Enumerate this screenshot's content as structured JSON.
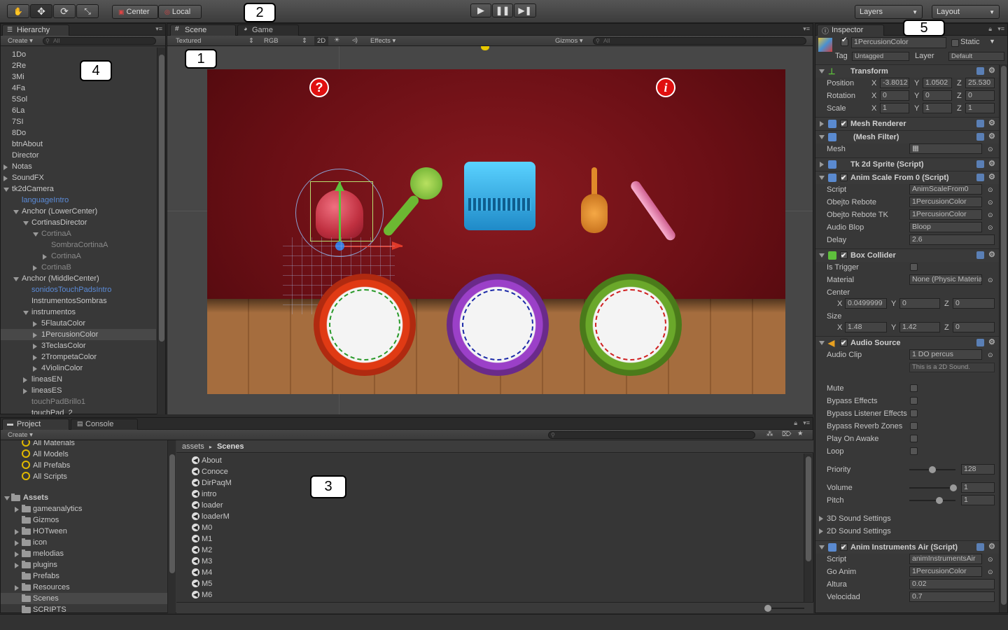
{
  "toolbar": {
    "pivot_center": "Center",
    "pivot_local": "Local",
    "layers": "Layers",
    "layout": "Layout"
  },
  "markers": [
    "1",
    "2",
    "3",
    "4",
    "5"
  ],
  "hierarchy": {
    "tab": "Hierarchy",
    "create": "Create",
    "search_placeholder": "All",
    "items": [
      {
        "label": "1Do"
      },
      {
        "label": "2Re"
      },
      {
        "label": "3Mi"
      },
      {
        "label": "4Fa"
      },
      {
        "label": "5Sol"
      },
      {
        "label": "6La"
      },
      {
        "label": "7SI"
      },
      {
        "label": "8Do"
      },
      {
        "label": "btnAbout"
      },
      {
        "label": "Director"
      },
      {
        "label": "Notas"
      },
      {
        "label": "SoundFX"
      },
      {
        "label": "tk2dCamera"
      },
      {
        "label": "languageIntro"
      },
      {
        "label": "Anchor (LowerCenter)"
      },
      {
        "label": "CortinasDirector"
      },
      {
        "label": "CortinaA"
      },
      {
        "label": "SombraCortinaA"
      },
      {
        "label": "CortinaA"
      },
      {
        "label": "CortinaB"
      },
      {
        "label": "Anchor (MiddleCenter)"
      },
      {
        "label": "sonidosTouchPadsIntro"
      },
      {
        "label": "InstrumentosSombras"
      },
      {
        "label": "instrumentos"
      },
      {
        "label": "5FlautaColor"
      },
      {
        "label": "1PercusionColor"
      },
      {
        "label": "3TeclasColor"
      },
      {
        "label": "2TrompetaColor"
      },
      {
        "label": "4ViolinColor"
      },
      {
        "label": "lineasEN"
      },
      {
        "label": "lineasES"
      },
      {
        "label": "touchPadBrillo1"
      },
      {
        "label": "touchPad_2"
      }
    ]
  },
  "scene": {
    "tab_scene": "Scene",
    "tab_game": "Game",
    "render_mode": "Textured",
    "color_mode": "RGB",
    "mode_2d": "2D",
    "effects": "Effects",
    "gizmos": "Gizmos",
    "search_placeholder": "All",
    "badge_question": "?",
    "badge_info": "i"
  },
  "project": {
    "tab_project": "Project",
    "tab_console": "Console",
    "create": "Create",
    "favorites": [
      {
        "label": "All Materials"
      },
      {
        "label": "All Models"
      },
      {
        "label": "All Prefabs"
      },
      {
        "label": "All Scripts"
      }
    ],
    "assets_root": "Assets",
    "folders": [
      {
        "label": "gameanalytics"
      },
      {
        "label": "Gizmos"
      },
      {
        "label": "HOTween"
      },
      {
        "label": "icon"
      },
      {
        "label": "melodias"
      },
      {
        "label": "plugins"
      },
      {
        "label": "Prefabs"
      },
      {
        "label": "Resources"
      },
      {
        "label": "Scenes"
      },
      {
        "label": "SCRIPTS"
      }
    ],
    "breadcrumb_root": "assets",
    "breadcrumb_current": "Scenes",
    "breadcrumb_sep": "▸",
    "files": [
      {
        "label": "About"
      },
      {
        "label": "Conoce"
      },
      {
        "label": "DirPaqM"
      },
      {
        "label": "intro"
      },
      {
        "label": "loader"
      },
      {
        "label": "loaderM"
      },
      {
        "label": "M0"
      },
      {
        "label": "M1"
      },
      {
        "label": "M2"
      },
      {
        "label": "M3"
      },
      {
        "label": "M4"
      },
      {
        "label": "M5"
      },
      {
        "label": "M6"
      }
    ]
  },
  "inspector": {
    "tab": "Inspector",
    "object_name": "1PercusionColor",
    "static": "Static",
    "tag_label": "Tag",
    "tag_value": "Untagged",
    "layer_label": "Layer",
    "layer_value": "Default",
    "transform": {
      "title": "Transform",
      "position": "Position",
      "rotation": "Rotation",
      "scale": "Scale",
      "x": "X",
      "y": "Y",
      "z": "Z",
      "pos": [
        "-3.8012",
        "1.0502",
        "25.530"
      ],
      "rot": [
        "0",
        "0",
        "0"
      ],
      "scl": [
        "1",
        "1",
        "1"
      ]
    },
    "mesh_renderer": "Mesh Renderer",
    "mesh_filter": "(Mesh Filter)",
    "mesh_label": "Mesh",
    "sprite": "Tk 2d Sprite (Script)",
    "anim_scale": {
      "title": "Anim Scale From 0 (Script)",
      "script_label": "Script",
      "script_value": "AnimScaleFrom0",
      "rebote_label": "Obejto Rebote",
      "rebote_value": "1PercusionColor",
      "rebote_tk_label": "Obejto Rebote TK",
      "rebote_tk_value": "1PercusionColor",
      "audio_label": "Audio Blop",
      "audio_value": "Bloop",
      "delay_label": "Delay",
      "delay_value": "2.6"
    },
    "box_collider": {
      "title": "Box Collider",
      "trigger_label": "Is Trigger",
      "material_label": "Material",
      "material_value": "None (Physic Material)",
      "center_label": "Center",
      "center": [
        "0.0499999",
        "0",
        "0"
      ],
      "size_label": "Size",
      "size": [
        "1.48",
        "1.42",
        "0"
      ]
    },
    "audio_source": {
      "title": "Audio Source",
      "clip_label": "Audio Clip",
      "clip_value": "1 DO percus",
      "sound_note": "This is a 2D Sound.",
      "toggles": [
        "Mute",
        "Bypass Effects",
        "Bypass Listener Effects",
        "Bypass Reverb Zones",
        "Play On Awake",
        "Loop"
      ],
      "priority_label": "Priority",
      "priority_value": "128",
      "volume_label": "Volume",
      "volume_value": "1",
      "pitch_label": "Pitch",
      "pitch_value": "1",
      "sound3d": "3D Sound Settings",
      "sound2d": "2D Sound Settings"
    },
    "anim_air": {
      "title": "Anim Instruments Air (Script)",
      "script_label": "Script",
      "script_value": "animInstrumentsAir",
      "go_label": "Go Anim",
      "go_value": "1PercusionColor",
      "altura_label": "Altura",
      "altura_value": "0.02",
      "vel_label": "Velocidad",
      "vel_value": "0.7"
    }
  },
  "colors": {
    "accent_blue": "#5b8bd8",
    "stage_red": "#7a1218",
    "floor_wood": "#b07a48",
    "selection": "#484848"
  }
}
